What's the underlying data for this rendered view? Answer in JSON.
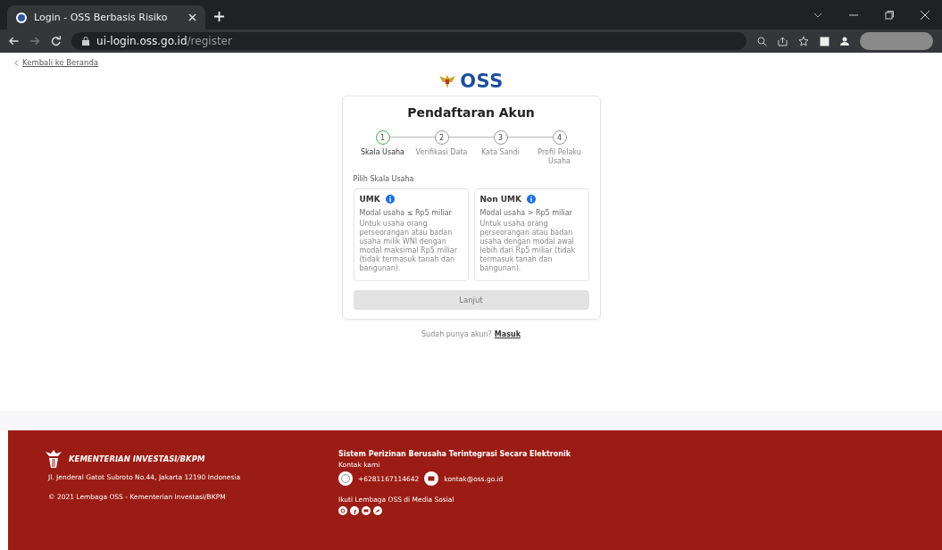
{
  "browser": {
    "tab_title": "Login - OSS Berbasis Risiko",
    "url_host": "ui-login.oss.go.id",
    "url_path": "/register"
  },
  "back_link": "Kembali ke Beranda",
  "logo_text": "OSS",
  "card": {
    "title": "Pendaftaran Akun",
    "steps": [
      {
        "number": "1",
        "label": "Skala Usaha",
        "selected": true
      },
      {
        "number": "2",
        "label": "Verifikasi Data",
        "selected": false
      },
      {
        "number": "3",
        "label": "Kata Sandi",
        "selected": false
      },
      {
        "number": "4",
        "label": "Profil Pelaku Usaha",
        "selected": false
      }
    ],
    "section_label": "Pilih Skala Usaha",
    "options": [
      {
        "title": "UMK",
        "subtitle": "Modal usaha ≤ Rp5 miliar",
        "description": "Untuk usaha orang perseorangan atau badan usaha milik WNI dengan modal maksimal Rp5 miliar (tidak termasuk tanah dan bangunan).",
        "selected": false
      },
      {
        "title": "Non UMK",
        "subtitle": "Modal usaha > Rp5 miliar",
        "description": "Untuk usaha orang perseorangan atau badan usaha dengan modal awal lebih dari Rp5 miliar (tidak termasuk tanah dan bangunan).",
        "selected": false
      }
    ],
    "button": {
      "label": "Lanjut",
      "disabled": true
    }
  },
  "login_prompt": {
    "text": "Sudah punya akun?",
    "link": "Masuk"
  },
  "footer": {
    "brand": "KEMENTERIAN INVESTASI/BKPM",
    "address": "Jl. Jenderal Gatot Subroto No.44, Jakarta 12190 Indonesia",
    "copyright": "© 2021 Lembaga OSS - Kementerian Investasi/BKPM",
    "system_name": "Sistem Perizinan Berusaha Terintegrasi Secara Elektronik",
    "contact_label": "Kontak kami",
    "phone": "+6281167114642",
    "email": "kontak@oss.go.id",
    "social_label": "Ikuti Lembaga OSS di Media Sosial"
  }
}
